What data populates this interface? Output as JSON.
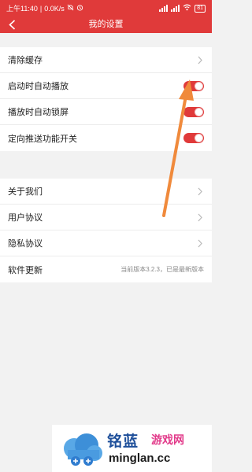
{
  "status_bar": {
    "time": "上午11:40",
    "network_speed": "0.0K/s",
    "battery": "81"
  },
  "header": {
    "title": "我的设置"
  },
  "group1": [
    {
      "label": "清除缓存",
      "control": "chevron"
    },
    {
      "label": "启动时自动播放",
      "control": "toggle",
      "on": true
    },
    {
      "label": "播放时自动锁屏",
      "control": "toggle",
      "on": true
    },
    {
      "label": "定向推送功能开关",
      "control": "toggle",
      "on": true
    }
  ],
  "group2": [
    {
      "label": "关于我们",
      "control": "chevron"
    },
    {
      "label": "用户协议",
      "control": "chevron"
    },
    {
      "label": "隐私协议",
      "control": "chevron"
    },
    {
      "label": "软件更新",
      "control": "text",
      "value": "当前版本3.2.3，已是最新版本"
    }
  ],
  "watermark": {
    "brand": "铭蓝",
    "tagline": "游戏网",
    "domain": "minglan.cc"
  },
  "colors": {
    "accent": "#e03a3a",
    "annotation_arrow": "#f08a3c",
    "brand_blue": "#1e4f9a",
    "brand_pink": "#e23a8a"
  }
}
